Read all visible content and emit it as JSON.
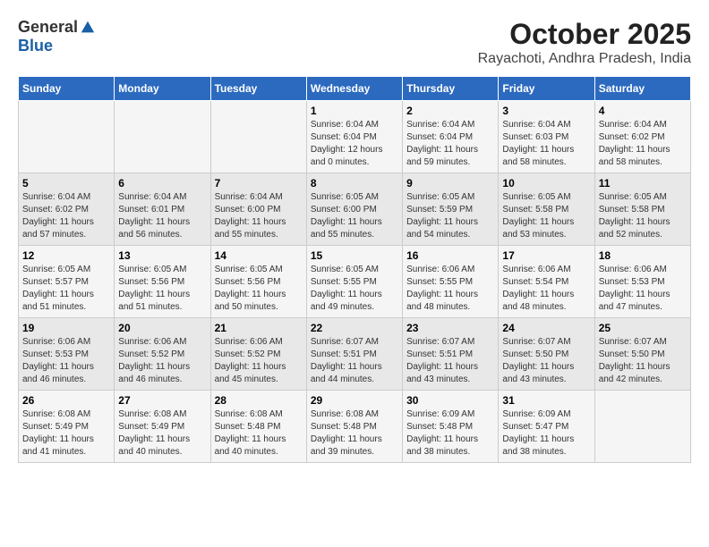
{
  "logo": {
    "general": "General",
    "blue": "Blue"
  },
  "title": "October 2025",
  "subtitle": "Rayachoti, Andhra Pradesh, India",
  "headers": [
    "Sunday",
    "Monday",
    "Tuesday",
    "Wednesday",
    "Thursday",
    "Friday",
    "Saturday"
  ],
  "weeks": [
    [
      {
        "day": "",
        "info": ""
      },
      {
        "day": "",
        "info": ""
      },
      {
        "day": "",
        "info": ""
      },
      {
        "day": "1",
        "info": "Sunrise: 6:04 AM\nSunset: 6:04 PM\nDaylight: 12 hours\nand 0 minutes."
      },
      {
        "day": "2",
        "info": "Sunrise: 6:04 AM\nSunset: 6:04 PM\nDaylight: 11 hours\nand 59 minutes."
      },
      {
        "day": "3",
        "info": "Sunrise: 6:04 AM\nSunset: 6:03 PM\nDaylight: 11 hours\nand 58 minutes."
      },
      {
        "day": "4",
        "info": "Sunrise: 6:04 AM\nSunset: 6:02 PM\nDaylight: 11 hours\nand 58 minutes."
      }
    ],
    [
      {
        "day": "5",
        "info": "Sunrise: 6:04 AM\nSunset: 6:02 PM\nDaylight: 11 hours\nand 57 minutes."
      },
      {
        "day": "6",
        "info": "Sunrise: 6:04 AM\nSunset: 6:01 PM\nDaylight: 11 hours\nand 56 minutes."
      },
      {
        "day": "7",
        "info": "Sunrise: 6:04 AM\nSunset: 6:00 PM\nDaylight: 11 hours\nand 55 minutes."
      },
      {
        "day": "8",
        "info": "Sunrise: 6:05 AM\nSunset: 6:00 PM\nDaylight: 11 hours\nand 55 minutes."
      },
      {
        "day": "9",
        "info": "Sunrise: 6:05 AM\nSunset: 5:59 PM\nDaylight: 11 hours\nand 54 minutes."
      },
      {
        "day": "10",
        "info": "Sunrise: 6:05 AM\nSunset: 5:58 PM\nDaylight: 11 hours\nand 53 minutes."
      },
      {
        "day": "11",
        "info": "Sunrise: 6:05 AM\nSunset: 5:58 PM\nDaylight: 11 hours\nand 52 minutes."
      }
    ],
    [
      {
        "day": "12",
        "info": "Sunrise: 6:05 AM\nSunset: 5:57 PM\nDaylight: 11 hours\nand 51 minutes."
      },
      {
        "day": "13",
        "info": "Sunrise: 6:05 AM\nSunset: 5:56 PM\nDaylight: 11 hours\nand 51 minutes."
      },
      {
        "day": "14",
        "info": "Sunrise: 6:05 AM\nSunset: 5:56 PM\nDaylight: 11 hours\nand 50 minutes."
      },
      {
        "day": "15",
        "info": "Sunrise: 6:05 AM\nSunset: 5:55 PM\nDaylight: 11 hours\nand 49 minutes."
      },
      {
        "day": "16",
        "info": "Sunrise: 6:06 AM\nSunset: 5:55 PM\nDaylight: 11 hours\nand 48 minutes."
      },
      {
        "day": "17",
        "info": "Sunrise: 6:06 AM\nSunset: 5:54 PM\nDaylight: 11 hours\nand 48 minutes."
      },
      {
        "day": "18",
        "info": "Sunrise: 6:06 AM\nSunset: 5:53 PM\nDaylight: 11 hours\nand 47 minutes."
      }
    ],
    [
      {
        "day": "19",
        "info": "Sunrise: 6:06 AM\nSunset: 5:53 PM\nDaylight: 11 hours\nand 46 minutes."
      },
      {
        "day": "20",
        "info": "Sunrise: 6:06 AM\nSunset: 5:52 PM\nDaylight: 11 hours\nand 46 minutes."
      },
      {
        "day": "21",
        "info": "Sunrise: 6:06 AM\nSunset: 5:52 PM\nDaylight: 11 hours\nand 45 minutes."
      },
      {
        "day": "22",
        "info": "Sunrise: 6:07 AM\nSunset: 5:51 PM\nDaylight: 11 hours\nand 44 minutes."
      },
      {
        "day": "23",
        "info": "Sunrise: 6:07 AM\nSunset: 5:51 PM\nDaylight: 11 hours\nand 43 minutes."
      },
      {
        "day": "24",
        "info": "Sunrise: 6:07 AM\nSunset: 5:50 PM\nDaylight: 11 hours\nand 43 minutes."
      },
      {
        "day": "25",
        "info": "Sunrise: 6:07 AM\nSunset: 5:50 PM\nDaylight: 11 hours\nand 42 minutes."
      }
    ],
    [
      {
        "day": "26",
        "info": "Sunrise: 6:08 AM\nSunset: 5:49 PM\nDaylight: 11 hours\nand 41 minutes."
      },
      {
        "day": "27",
        "info": "Sunrise: 6:08 AM\nSunset: 5:49 PM\nDaylight: 11 hours\nand 40 minutes."
      },
      {
        "day": "28",
        "info": "Sunrise: 6:08 AM\nSunset: 5:48 PM\nDaylight: 11 hours\nand 40 minutes."
      },
      {
        "day": "29",
        "info": "Sunrise: 6:08 AM\nSunset: 5:48 PM\nDaylight: 11 hours\nand 39 minutes."
      },
      {
        "day": "30",
        "info": "Sunrise: 6:09 AM\nSunset: 5:48 PM\nDaylight: 11 hours\nand 38 minutes."
      },
      {
        "day": "31",
        "info": "Sunrise: 6:09 AM\nSunset: 5:47 PM\nDaylight: 11 hours\nand 38 minutes."
      },
      {
        "day": "",
        "info": ""
      }
    ]
  ]
}
